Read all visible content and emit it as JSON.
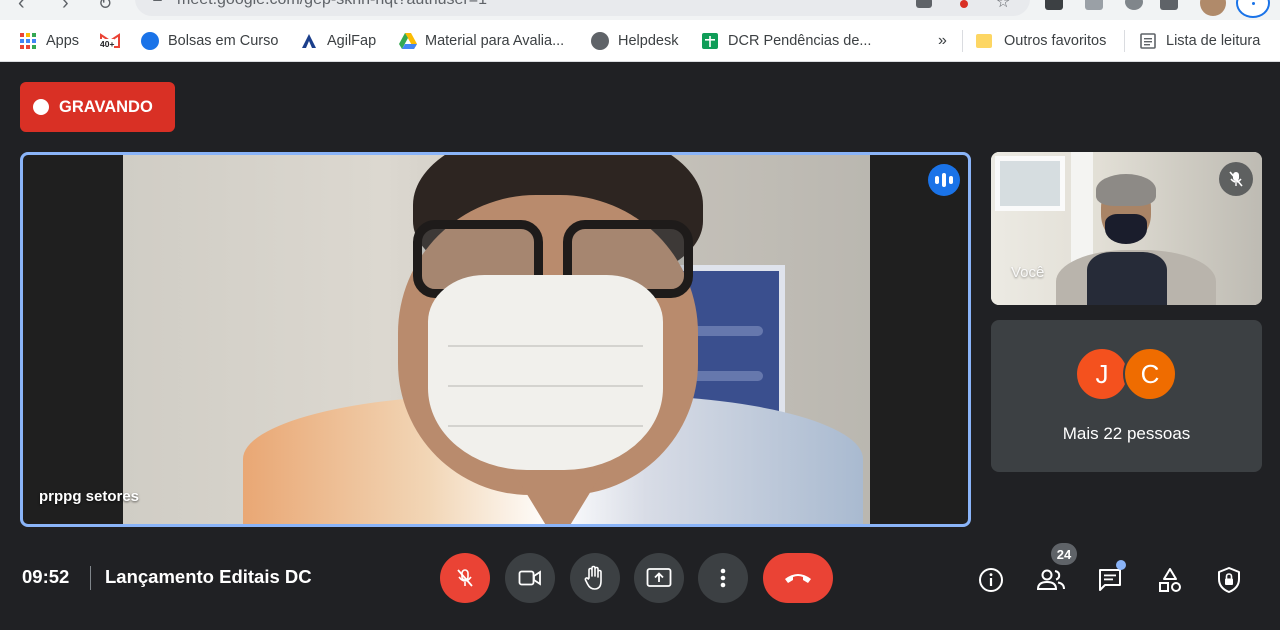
{
  "browser": {
    "url": "meet.google.com/gep-sknh-hqt?authuser=1",
    "bookmarks": [
      {
        "label": "Apps",
        "icon": "apps-grid-icon"
      },
      {
        "label": "40+",
        "icon": "gmail-icon"
      },
      {
        "label": "Bolsas em Curso",
        "icon": "bolsas-icon"
      },
      {
        "label": "AgilFap",
        "icon": "agilfap-icon"
      },
      {
        "label": "Material para Avalia...",
        "icon": "google-drive-icon"
      },
      {
        "label": "Helpdesk",
        "icon": "globe-icon"
      },
      {
        "label": "DCR Pendências de...",
        "icon": "google-sheets-icon"
      }
    ],
    "overflow": "»",
    "other_favorites": "Outros favoritos",
    "reading_list": "Lista de leitura"
  },
  "meet": {
    "recording_label": "GRAVANDO",
    "main_speaker": "prppg setores",
    "self_label": "Você",
    "others": {
      "avatars": [
        {
          "initial": "J",
          "color": "#f4511e"
        },
        {
          "initial": "C",
          "color": "#ef6c00"
        }
      ],
      "more_label": "Mais 22 pessoas"
    },
    "time": "09:52",
    "meeting_title": "Lançamento Editais DC",
    "participant_count": "24"
  },
  "colors": {
    "accent": "#1a73e8",
    "recording": "#d93025",
    "end_call": "#ea4335",
    "background": "#202124"
  }
}
